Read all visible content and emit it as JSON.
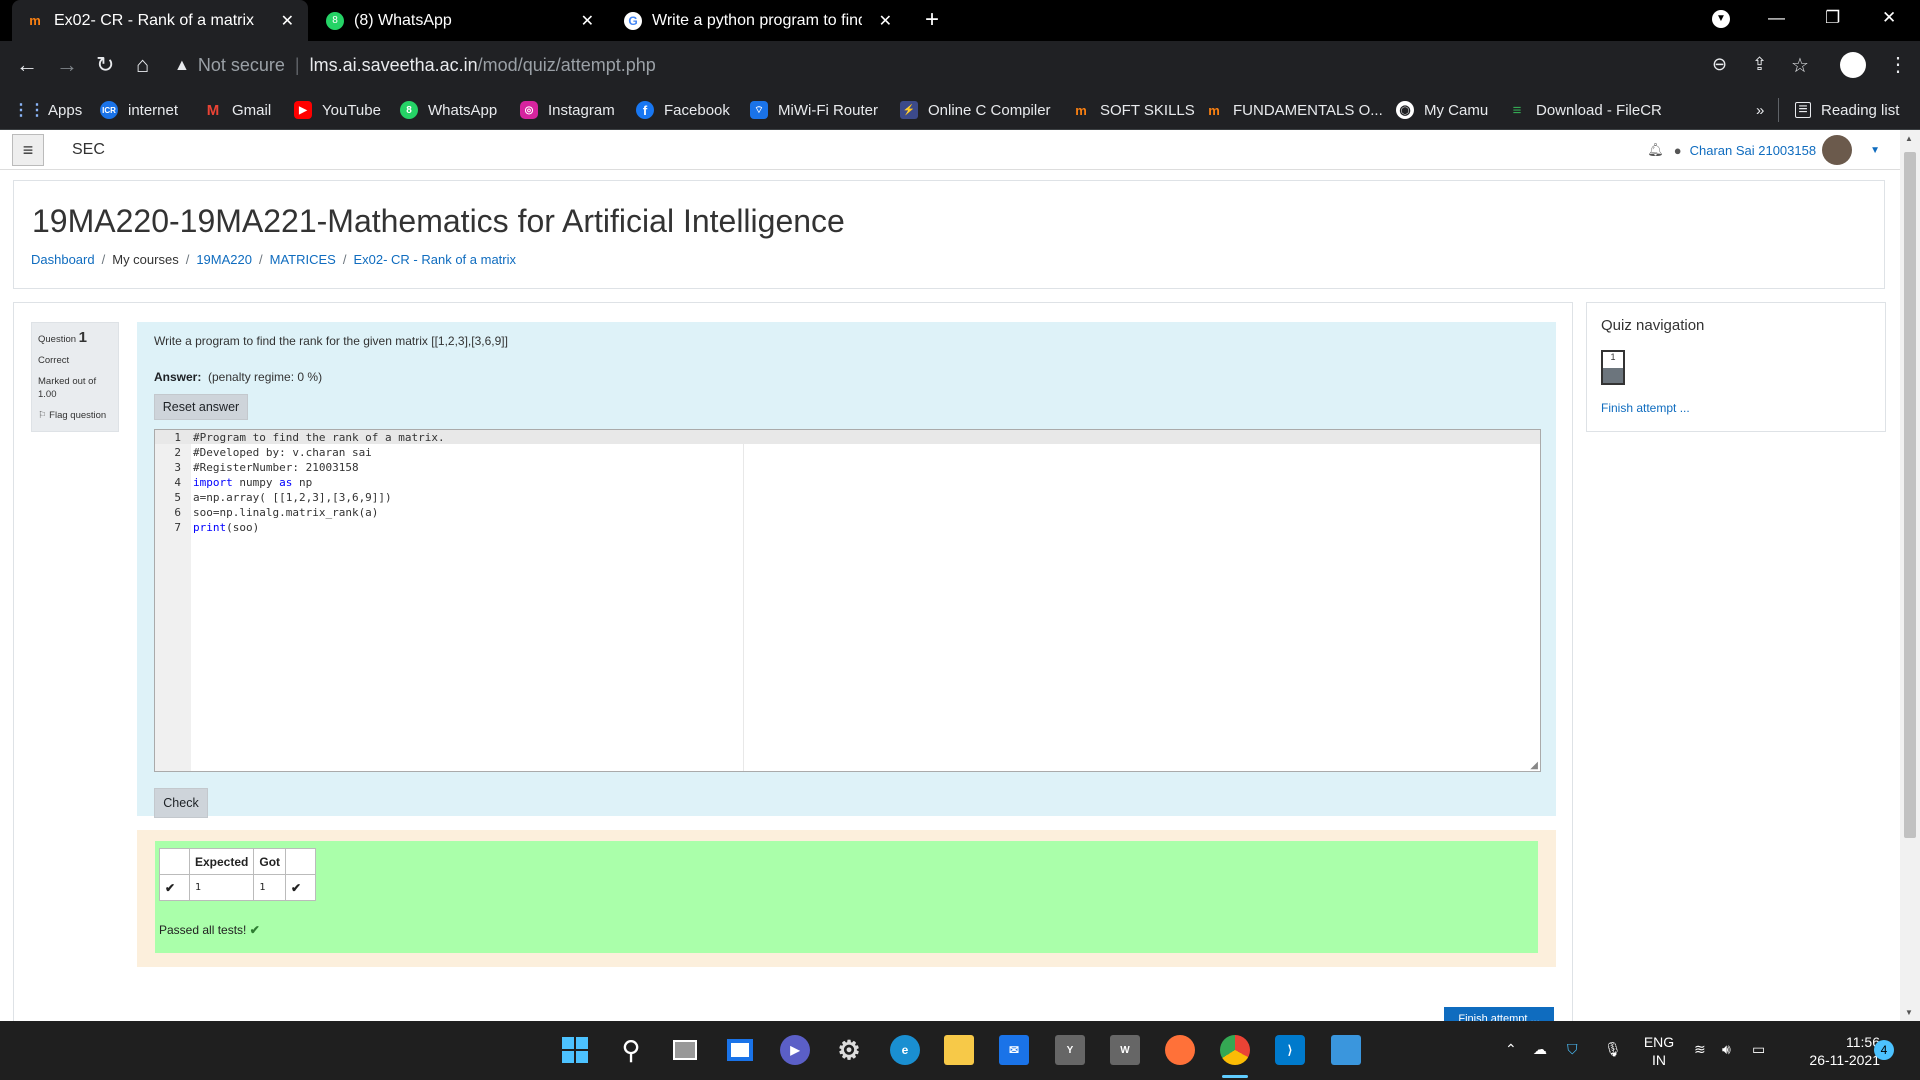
{
  "tabs": [
    {
      "title": "Ex02- CR - Rank of a matrix",
      "icon": "moodle-icon"
    },
    {
      "title": "(8) WhatsApp",
      "icon": "whatsapp-icon"
    },
    {
      "title": "Write a python program to find t",
      "icon": "google-icon"
    }
  ],
  "address": {
    "security": "Not secure",
    "host": "lms.ai.saveetha.ac.in",
    "path": "/mod/quiz/attempt.php"
  },
  "bookmarks": [
    {
      "label": "Apps"
    },
    {
      "label": "internet"
    },
    {
      "label": "Gmail"
    },
    {
      "label": "YouTube"
    },
    {
      "label": "WhatsApp"
    },
    {
      "label": "Instagram"
    },
    {
      "label": "Facebook"
    },
    {
      "label": "MiWi-Fi Router"
    },
    {
      "label": "Online C Compiler"
    },
    {
      "label": "SOFT SKILLS"
    },
    {
      "label": "FUNDAMENTALS O..."
    },
    {
      "label": "My Camu"
    },
    {
      "label": "Download - FileCR"
    }
  ],
  "bookmarks_more": "»",
  "reading_list": "Reading list",
  "site": {
    "name": "SEC",
    "user": "Charan Sai 21003158"
  },
  "course": {
    "title": "19MA220-19MA221-Mathematics for Artificial Intelligence",
    "breadcrumb": [
      "Dashboard",
      "My courses",
      "19MA220",
      "MATRICES",
      "Ex02- CR - Rank of a matrix"
    ]
  },
  "question": {
    "label": "Question",
    "number": "1",
    "state": "Correct",
    "marked": "Marked out of",
    "max_mark": "1.00",
    "flag": "Flag question",
    "text": "Write a program to find the rank for the given matrix [[1,2,3],[3,6,9]]",
    "answer_label": "Answer:",
    "penalty": "(penalty regime: 0 %)",
    "reset_label": "Reset answer",
    "check_label": "Check"
  },
  "code": [
    "#Program to find the rank of a matrix.",
    "#Developed by: v.charan sai",
    "#RegisterNumber: 21003158",
    "import numpy as np",
    "a=np.array( [[1,2,3],[3,6,9]])",
    "soo=np.linalg.matrix_rank(a)",
    "print(soo)"
  ],
  "results": {
    "headers": [
      "Expected",
      "Got"
    ],
    "expected": "1",
    "got": "1",
    "passed": "Passed all tests!"
  },
  "quiz_nav": {
    "title": "Quiz navigation",
    "question": "1",
    "finish": "Finish attempt ..."
  },
  "finish_button": "Finish attempt ...",
  "taskbar": {
    "lang": "ENG",
    "region": "IN",
    "time": "11:56",
    "date": "26-11-2021",
    "notifications": "4"
  }
}
